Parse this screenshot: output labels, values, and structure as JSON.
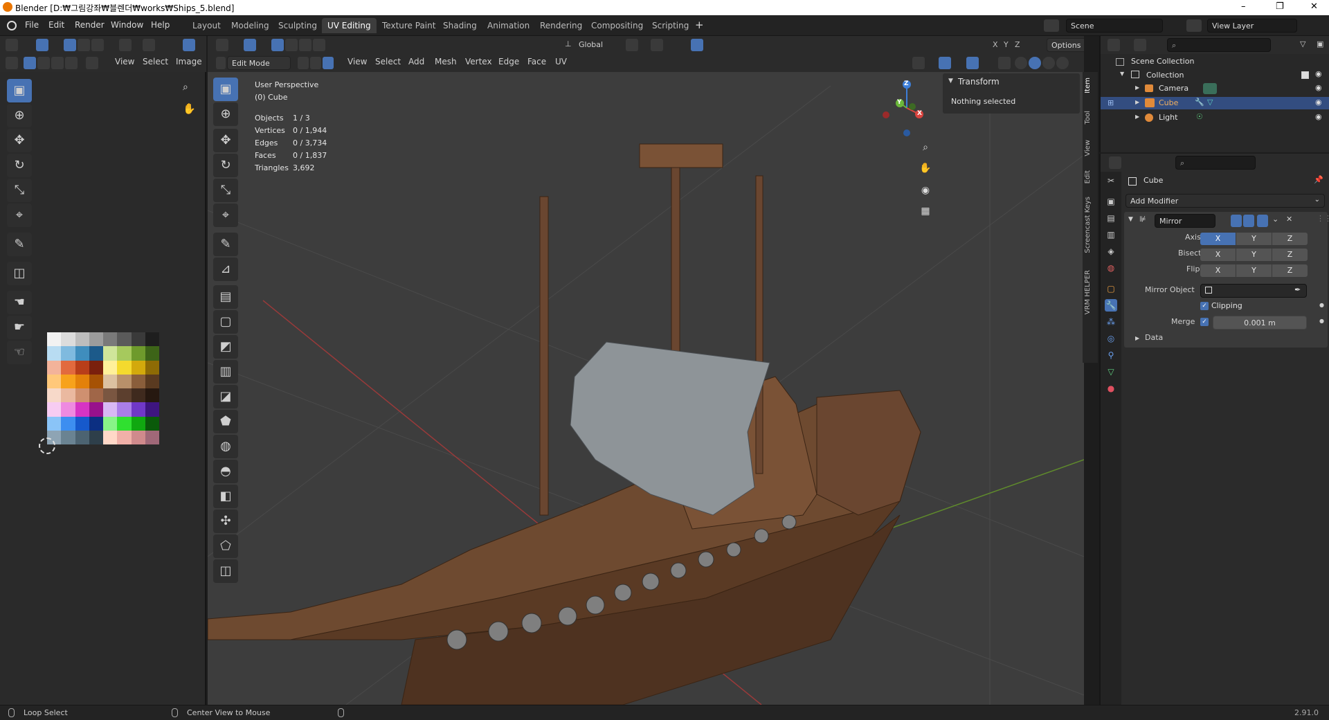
{
  "window": {
    "title": "Blender [D:₩그림강좌₩블렌더₩works₩Ships_5.blend]",
    "minimize": "–",
    "maximize": "❐",
    "close": "✕"
  },
  "menubar": [
    "File",
    "Edit",
    "Render",
    "Window",
    "Help"
  ],
  "workspaces": [
    "Layout",
    "Modeling",
    "Sculpting",
    "UV Editing",
    "Texture Paint",
    "Shading",
    "Animation",
    "Rendering",
    "Compositing",
    "Scripting"
  ],
  "active_workspace": "UV Editing",
  "add_workspace": "+",
  "scene": {
    "label": "Scene"
  },
  "view_layer": {
    "label": "View Layer"
  },
  "uv_editor": {
    "menus": [
      "View",
      "Select",
      "Image"
    ]
  },
  "viewport": {
    "mode": "Edit Mode",
    "menus": [
      "View",
      "Select",
      "Add",
      "Mesh",
      "Vertex",
      "Edge",
      "Face",
      "UV"
    ],
    "orientation": "Global",
    "axes": [
      "X",
      "Y",
      "Z"
    ],
    "options": "Options",
    "perspective": "User Perspective",
    "object": "(0) Cube",
    "stats": [
      {
        "label": "Objects",
        "value": "1 / 3"
      },
      {
        "label": "Vertices",
        "value": "0 / 1,944"
      },
      {
        "label": "Edges",
        "value": "0 / 3,734"
      },
      {
        "label": "Faces",
        "value": "0 / 1,837"
      },
      {
        "label": "Triangles",
        "value": "3,692"
      }
    ],
    "gizmo": {
      "x": "X",
      "y": "Y",
      "z": "Z"
    }
  },
  "sidebar": {
    "panel": "Transform",
    "content": "Nothing selected",
    "tabs": [
      "Item",
      "Tool",
      "View",
      "Edit",
      "Screencast Keys",
      "VRM HELPER"
    ]
  },
  "outliner": {
    "root": "Scene Collection",
    "collection": "Collection",
    "items": [
      {
        "name": "Camera",
        "selected": false
      },
      {
        "name": "Cube",
        "selected": true
      },
      {
        "name": "Light",
        "selected": false
      }
    ]
  },
  "properties": {
    "object": "Cube",
    "add_modifier": "Add Modifier",
    "modifier": {
      "name": "Mirror",
      "axis_label": "Axis",
      "bisect_label": "Bisect",
      "flip_label": "Flip",
      "axis": [
        "X",
        "Y",
        "Z"
      ],
      "mirror_object_label": "Mirror Object",
      "clipping": "Clipping",
      "merge_label": "Merge",
      "merge_value": "0.001 m",
      "data": "Data"
    }
  },
  "status": {
    "left": "Loop Select",
    "middle": "Center View to Mouse",
    "version": "2.91.0"
  },
  "palette": {
    "rows": [
      [
        "#f2f2f2",
        "#dcdcdc",
        "#bdbdbd",
        "#9c9c9c",
        "#7a7a7a",
        "#5a5a5a",
        "#3a3a3a",
        "#1e1e1e"
      ],
      [
        "#b8dcf2",
        "#7fbadf",
        "#3f8dbd",
        "#1c5a8a",
        "#cfe59a",
        "#a6c95d",
        "#6e9a2c",
        "#3d6418"
      ],
      [
        "#f3b39a",
        "#e26a3e",
        "#b83e1a",
        "#7a200d",
        "#fff09a",
        "#f4da2e",
        "#d3a90c",
        "#8e6b05"
      ],
      [
        "#ffc87a",
        "#f7a21c",
        "#e3810a",
        "#a65205",
        "#dcc1a1",
        "#b8906a",
        "#8a5e3b",
        "#5a3a20"
      ],
      [
        "#f7d9c9",
        "#eab9a0",
        "#cf9070",
        "#a06648",
        "#7a5641",
        "#5c3f2e",
        "#3f2a1e",
        "#261810"
      ],
      [
        "#f7ccf2",
        "#ee8ae0",
        "#d634c4",
        "#98118c",
        "#d8b8f4",
        "#aa7ee8",
        "#7038c8",
        "#3e1580"
      ],
      [
        "#8ac4f7",
        "#3d8ef0",
        "#1659cc",
        "#0c2f82",
        "#88f488",
        "#30e030",
        "#10a810",
        "#0a5a0a"
      ],
      [
        "#8ea4b4",
        "#6a8392",
        "#4c6371",
        "#2e3f4a",
        "#ffd8c8",
        "#f0b0a8",
        "#d08a8c",
        "#a06878"
      ]
    ]
  }
}
